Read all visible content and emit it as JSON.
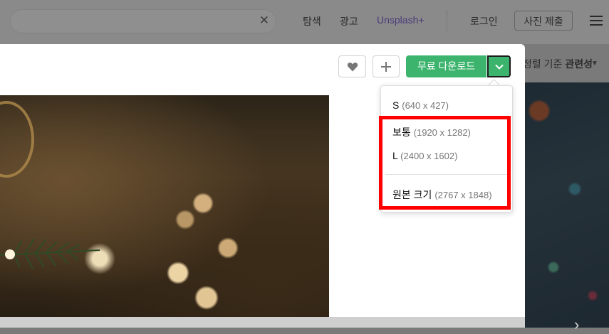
{
  "header": {
    "search": {
      "clear_icon": "close-icon"
    },
    "nav": {
      "explore": "탐색",
      "advertise": "광고",
      "unsplash_plus": "Unsplash+"
    },
    "login": "로그인",
    "submit_photo": "사진 제출",
    "menu_icon": "hamburger-menu-icon"
  },
  "sort": {
    "prefix": "정렬 기준",
    "value": "관련성"
  },
  "modal": {
    "like_icon": "heart-icon",
    "collect_icon": "plus-icon",
    "download_label": "무료 다운로드",
    "toggle_icon": "chevron-down-icon"
  },
  "download_menu": {
    "items": [
      {
        "label": "S",
        "dims": "(640 x 427)"
      },
      {
        "label": "보통",
        "dims": "(1920 x 1282)"
      },
      {
        "label": "L",
        "dims": "(2400 x 1602)"
      },
      {
        "label": "원본 크기",
        "dims": "(2767 x 1848)"
      }
    ]
  },
  "colors": {
    "accent_green": "#3cb46e",
    "highlight_red": "#ff0000"
  }
}
